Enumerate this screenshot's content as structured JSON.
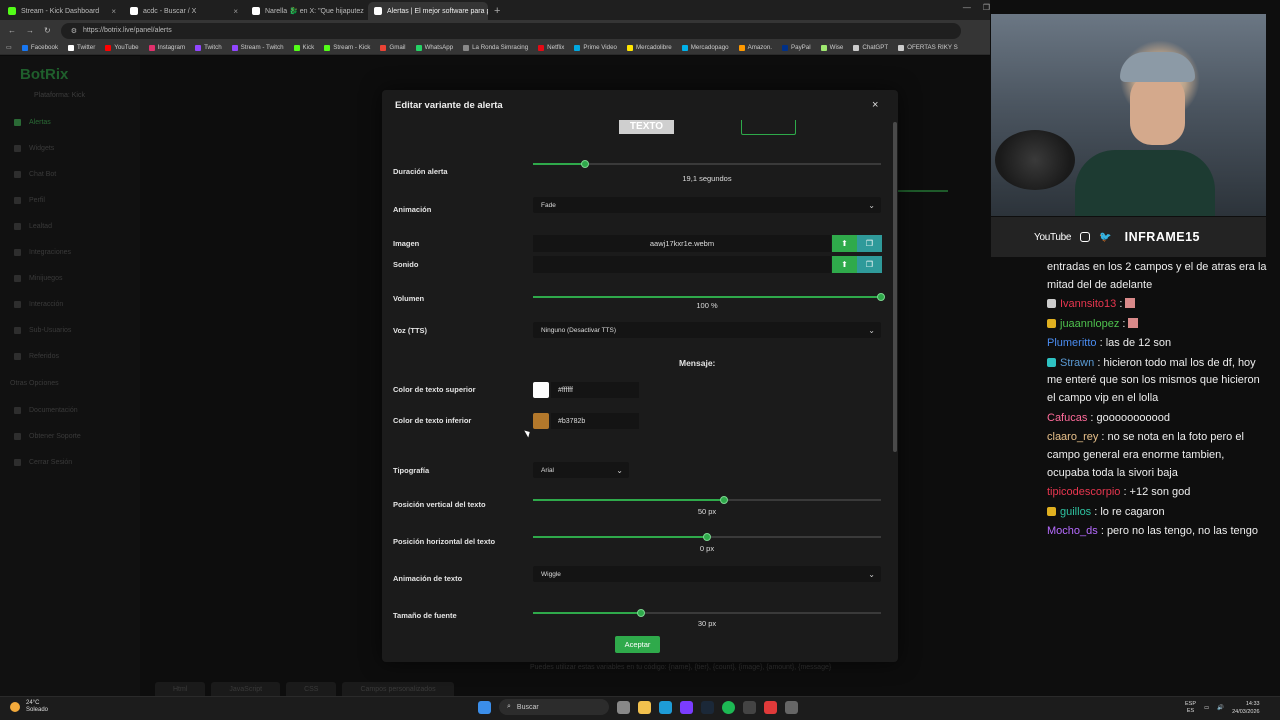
{
  "browser": {
    "tabs": [
      {
        "title": "Stream - Kick Dashboard",
        "color": "#53fc18",
        "active": false
      },
      {
        "title": "acdc - Buscar / X",
        "color": "#ffffff",
        "active": false
      },
      {
        "title": "Narella 🐉 en X: \"Que hijaputez la...",
        "color": "#ffffff",
        "active": false
      },
      {
        "title": "Alertas | El mejor software para pe...",
        "color": "#ffffff",
        "active": true
      }
    ],
    "new_tab": "+",
    "url": "https://botrix.live/panel/alerts",
    "bookmarks": [
      {
        "label": "Facebook",
        "color": "#1877f2"
      },
      {
        "label": "Twitter",
        "color": "#ffffff"
      },
      {
        "label": "YouTube",
        "color": "#ff0000"
      },
      {
        "label": "Instagram",
        "color": "#e1306c"
      },
      {
        "label": "Twitch",
        "color": "#9146ff"
      },
      {
        "label": "Stream - Twitch",
        "color": "#9146ff"
      },
      {
        "label": "Kick",
        "color": "#53fc18"
      },
      {
        "label": "Stream - Kick",
        "color": "#53fc18"
      },
      {
        "label": "Gmail",
        "color": "#ea4335"
      },
      {
        "label": "WhatsApp",
        "color": "#25d366"
      },
      {
        "label": "La Ronda Simracing",
        "color": "#888888"
      },
      {
        "label": "Netflix",
        "color": "#e50914"
      },
      {
        "label": "Prime Video",
        "color": "#00a8e1"
      },
      {
        "label": "Mercadolibre",
        "color": "#ffe600"
      },
      {
        "label": "Mercadopago",
        "color": "#00b1ea"
      },
      {
        "label": "Amazon.",
        "color": "#ff9900"
      },
      {
        "label": "PayPal",
        "color": "#003087"
      },
      {
        "label": "Wise",
        "color": "#9fe870"
      },
      {
        "label": "ChatGPT",
        "color": "#cccccc"
      },
      {
        "label": "OFERTAS RIKY S",
        "color": "#cccccc"
      }
    ]
  },
  "app": {
    "logo": "BotRix",
    "platform": "Plataforma: Kick",
    "nav": [
      {
        "label": "Alertas",
        "active": true
      },
      {
        "label": "Widgets",
        "active": false
      },
      {
        "label": "Chat Bot",
        "active": false
      },
      {
        "label": "Perfil",
        "active": false
      },
      {
        "label": "Lealtad",
        "active": false
      },
      {
        "label": "Integraciones",
        "active": false
      },
      {
        "label": "Minijuegos",
        "active": false
      },
      {
        "label": "Interacción",
        "active": false
      },
      {
        "label": "Sub-Usuarios",
        "active": false
      },
      {
        "label": "Referidos",
        "active": false
      }
    ],
    "other_title": "Otras Opciones",
    "other_nav": [
      "Documentación",
      "Obtener Soporte",
      "Cerrar Sesión"
    ],
    "bottom_tabs": [
      "Html",
      "JavaScript",
      "CSS",
      "Campos personalizados"
    ],
    "variables_hint": "Puedes utilizar estas variables en tu código: {name}, {tier}, {count}, {image}, {amount}, {message}"
  },
  "modal": {
    "title": "Editar variante de alerta",
    "close": "×",
    "preview_text": "TEXTO",
    "duration": {
      "label": "Duración alerta",
      "value_text": "19,1 segundos",
      "fraction": 0.15
    },
    "animation": {
      "label": "Animación",
      "value": "Fade"
    },
    "image": {
      "label": "Imagen",
      "file": "aawj17kxr1e.webm"
    },
    "sound": {
      "label": "Sonido",
      "file": ""
    },
    "volume": {
      "label": "Volumen",
      "value": "100",
      "unit": "%",
      "fraction": 1.0
    },
    "voice": {
      "label": "Voz (TTS)",
      "value": "Ninguno (Desactivar TTS)"
    },
    "message_heading": "Mensaje:",
    "top_color": {
      "label": "Color de texto superior",
      "hex": "#ffffff",
      "swatch": "#ffffff"
    },
    "bottom_color": {
      "label": "Color de texto inferior",
      "hex": "#b3782b",
      "swatch": "#b3782b"
    },
    "typography": {
      "label": "Tipografía",
      "value": "Arial"
    },
    "vertical_pos": {
      "label": "Posición vertical del texto",
      "value": "50",
      "unit": "px",
      "fraction": 0.55
    },
    "horizontal_pos": {
      "label": "Posición horizontal del texto",
      "value": "0",
      "unit": "px",
      "fraction": 0.5
    },
    "text_animation": {
      "label": "Animación de texto",
      "value": "Wiggle"
    },
    "font_size": {
      "label": "Tamaño de fuente",
      "value": "30",
      "unit": "px",
      "fraction": 0.31
    },
    "accept": "Aceptar"
  },
  "stream": {
    "social_youtube": "YouTube",
    "channel": "INFRAME15",
    "chat": [
      {
        "user": "",
        "color": "#ffffff",
        "text": "entradas en los 2 campos y el de atras era la mitad del de adelante"
      },
      {
        "user": "Ivannsito13",
        "color": "#e8364f",
        "text": ":",
        "badge": "#cccccc",
        "emote": true
      },
      {
        "user": "juaannlopez",
        "color": "#4ec24e",
        "text": ":",
        "badge": "#e0b020",
        "emote": true
      },
      {
        "user": "Plumeritto",
        "color": "#4a8cf0",
        "text": ": las de 12 son"
      },
      {
        "user": "Strawn",
        "color": "#5b9bd5",
        "text": ": hicieron todo mal los de df, hoy me enteré que son los mismos que hicieron el campo vip en el lolla",
        "badge": "#2ec2c2"
      },
      {
        "user": "Cafucas",
        "color": "#ff6b9a",
        "text": ": gooooooooood"
      },
      {
        "user": "claaro_rey",
        "color": "#e8c08a",
        "text": ": no se nota en la foto pero el campo general era enorme tambien, ocupaba toda la sivori baja"
      },
      {
        "user": "tipicodescorpio",
        "color": "#e8364f",
        "text": ": +12 son god"
      },
      {
        "user": "guillos",
        "color": "#2ec2a0",
        "text": ": lo re cagaron",
        "badge": "#e0b020"
      },
      {
        "user": "Mocho_ds",
        "color": "#b66bff",
        "text": ": pero no las tengo, no las tengo"
      }
    ]
  },
  "taskbar": {
    "temp": "24°C",
    "weather": "Soleado",
    "search": "Buscar",
    "lang": "ESP",
    "region": "ES",
    "time": "14:33",
    "date": "24/03/2026"
  }
}
